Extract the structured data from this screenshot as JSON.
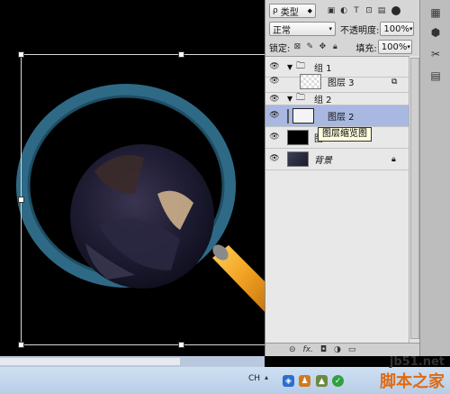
{
  "layers_panel": {
    "filter_kind": "类型",
    "blend_mode": "正常",
    "opacity_label": "不透明度:",
    "opacity_value": "100%",
    "lock_label": "锁定:",
    "fill_label": "填充:",
    "fill_value": "100%",
    "layers": [
      {
        "name": "组 1",
        "kind": "group"
      },
      {
        "name": "图层 3",
        "kind": "layer"
      },
      {
        "name": "组 2",
        "kind": "group"
      },
      {
        "name": "图层 2",
        "kind": "layer",
        "selected": true
      },
      {
        "name": "图",
        "kind": "layer"
      },
      {
        "name": "背景",
        "kind": "background"
      }
    ],
    "tooltip": "图层缩览图",
    "footer": {
      "link": "⊝",
      "fx": "fx."
    }
  },
  "taskbar": {
    "ime": "CH"
  },
  "watermark": {
    "url": "jb51.net",
    "name": "脚本之家"
  },
  "colors": {
    "selection": "#a9b8e0",
    "ring": "#2e6a86",
    "handle_gold": "#f0a020"
  }
}
